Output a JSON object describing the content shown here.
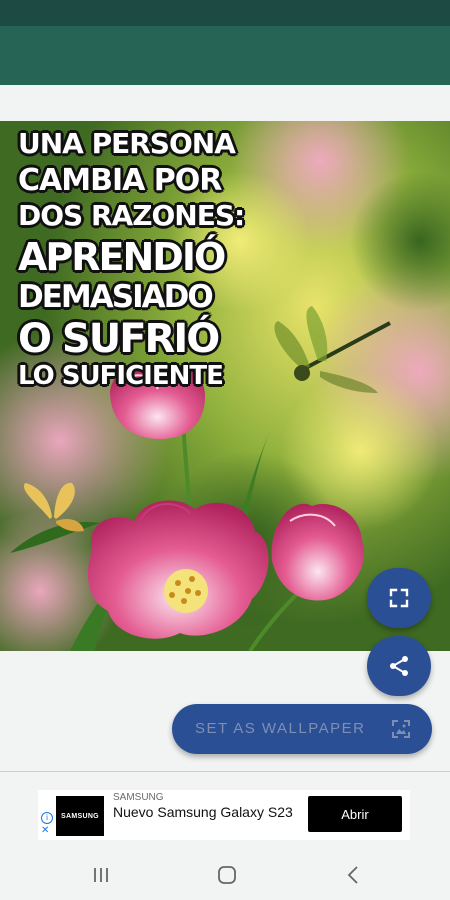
{
  "wallpaper": {
    "quote_lines": [
      "UNA PERSONA",
      "CAMBIA POR",
      "DOS RAZONES:",
      "APRENDIÓ",
      "DEMASIADO",
      "O SUFRIÓ",
      "LO SUFICIENTE"
    ]
  },
  "actions": {
    "expand_icon": "fullscreen-icon",
    "share_icon": "share-icon",
    "set_wallpaper_label": "SET AS WALLPAPER",
    "set_wallpaper_icon": "wallpaper-icon"
  },
  "ad": {
    "logo_text": "SAMSUNG",
    "sponsor": "SAMSUNG",
    "title": "Nuevo Samsung Galaxy S23",
    "cta": "Abrir",
    "info_icon": "info-icon",
    "close_icon": "close-icon"
  },
  "nav": {
    "recents_icon": "recents-icon",
    "home_icon": "home-icon",
    "back_icon": "back-icon"
  },
  "colors": {
    "status_bar": "#1e4a44",
    "app_bar": "#266456",
    "fab": "#2b4f94",
    "background": "#f2f4f3"
  }
}
